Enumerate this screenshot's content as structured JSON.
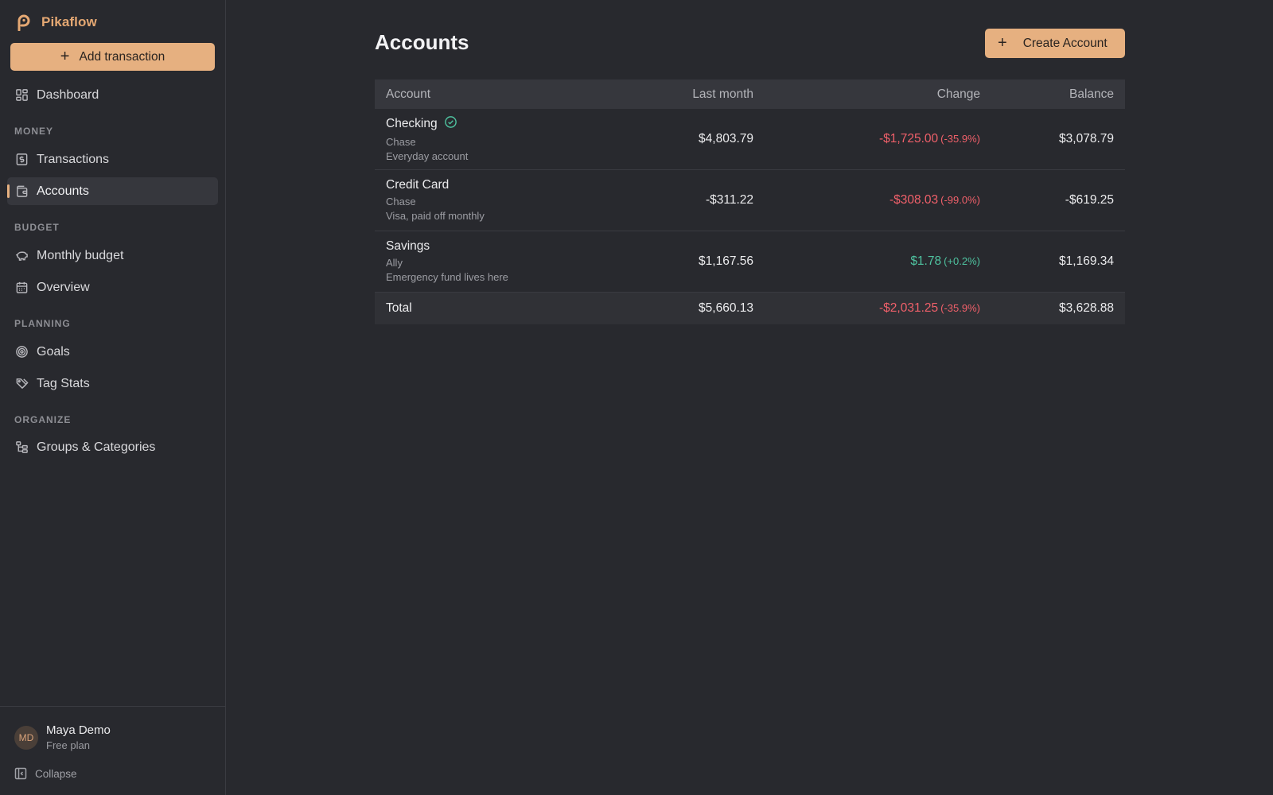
{
  "app": {
    "name": "Pikaflow",
    "brand_color": "#e5a873",
    "accent_color": "#e6b080",
    "negative_color": "#f0606a",
    "positive_color": "#4fc3a0"
  },
  "sidebar": {
    "add_button_label": "Add transaction",
    "dashboard_label": "Dashboard",
    "sections": {
      "money": "MONEY",
      "budget": "BUDGET",
      "planning": "PLANNING",
      "organize": "ORGANIZE"
    },
    "items": {
      "transactions": "Transactions",
      "accounts": "Accounts",
      "monthly_budget": "Monthly budget",
      "overview": "Overview",
      "goals": "Goals",
      "tag_stats": "Tag Stats",
      "groups_categories": "Groups & Categories"
    },
    "active_item": "Accounts",
    "user": {
      "initials": "MD",
      "name": "Maya Demo",
      "plan": "Free plan"
    },
    "collapse_label": "Collapse"
  },
  "main": {
    "title": "Accounts",
    "create_button_label": "Create Account",
    "table": {
      "headers": {
        "account": "Account",
        "last_month": "Last month",
        "change": "Change",
        "balance": "Balance"
      },
      "rows": [
        {
          "name": "Checking",
          "verified": true,
          "institution": "Chase",
          "note": "Everyday account",
          "last_month": "$4,803.79",
          "change": "-$1,725.00",
          "change_pct": "(-35.9%)",
          "change_direction": "negative",
          "balance": "$3,078.79"
        },
        {
          "name": "Credit Card",
          "verified": false,
          "institution": "Chase",
          "note": "Visa, paid off monthly",
          "last_month": "-$311.22",
          "change": "-$308.03",
          "change_pct": "(-99.0%)",
          "change_direction": "negative",
          "balance": "-$619.25"
        },
        {
          "name": "Savings",
          "verified": false,
          "institution": "Ally",
          "note": "Emergency fund lives here",
          "last_month": "$1,167.56",
          "change": "$1.78",
          "change_pct": "(+0.2%)",
          "change_direction": "positive",
          "balance": "$1,169.34"
        }
      ],
      "total": {
        "label": "Total",
        "last_month": "$5,660.13",
        "change": "-$2,031.25",
        "change_pct": "(-35.9%)",
        "balance": "$3,628.88"
      }
    }
  }
}
